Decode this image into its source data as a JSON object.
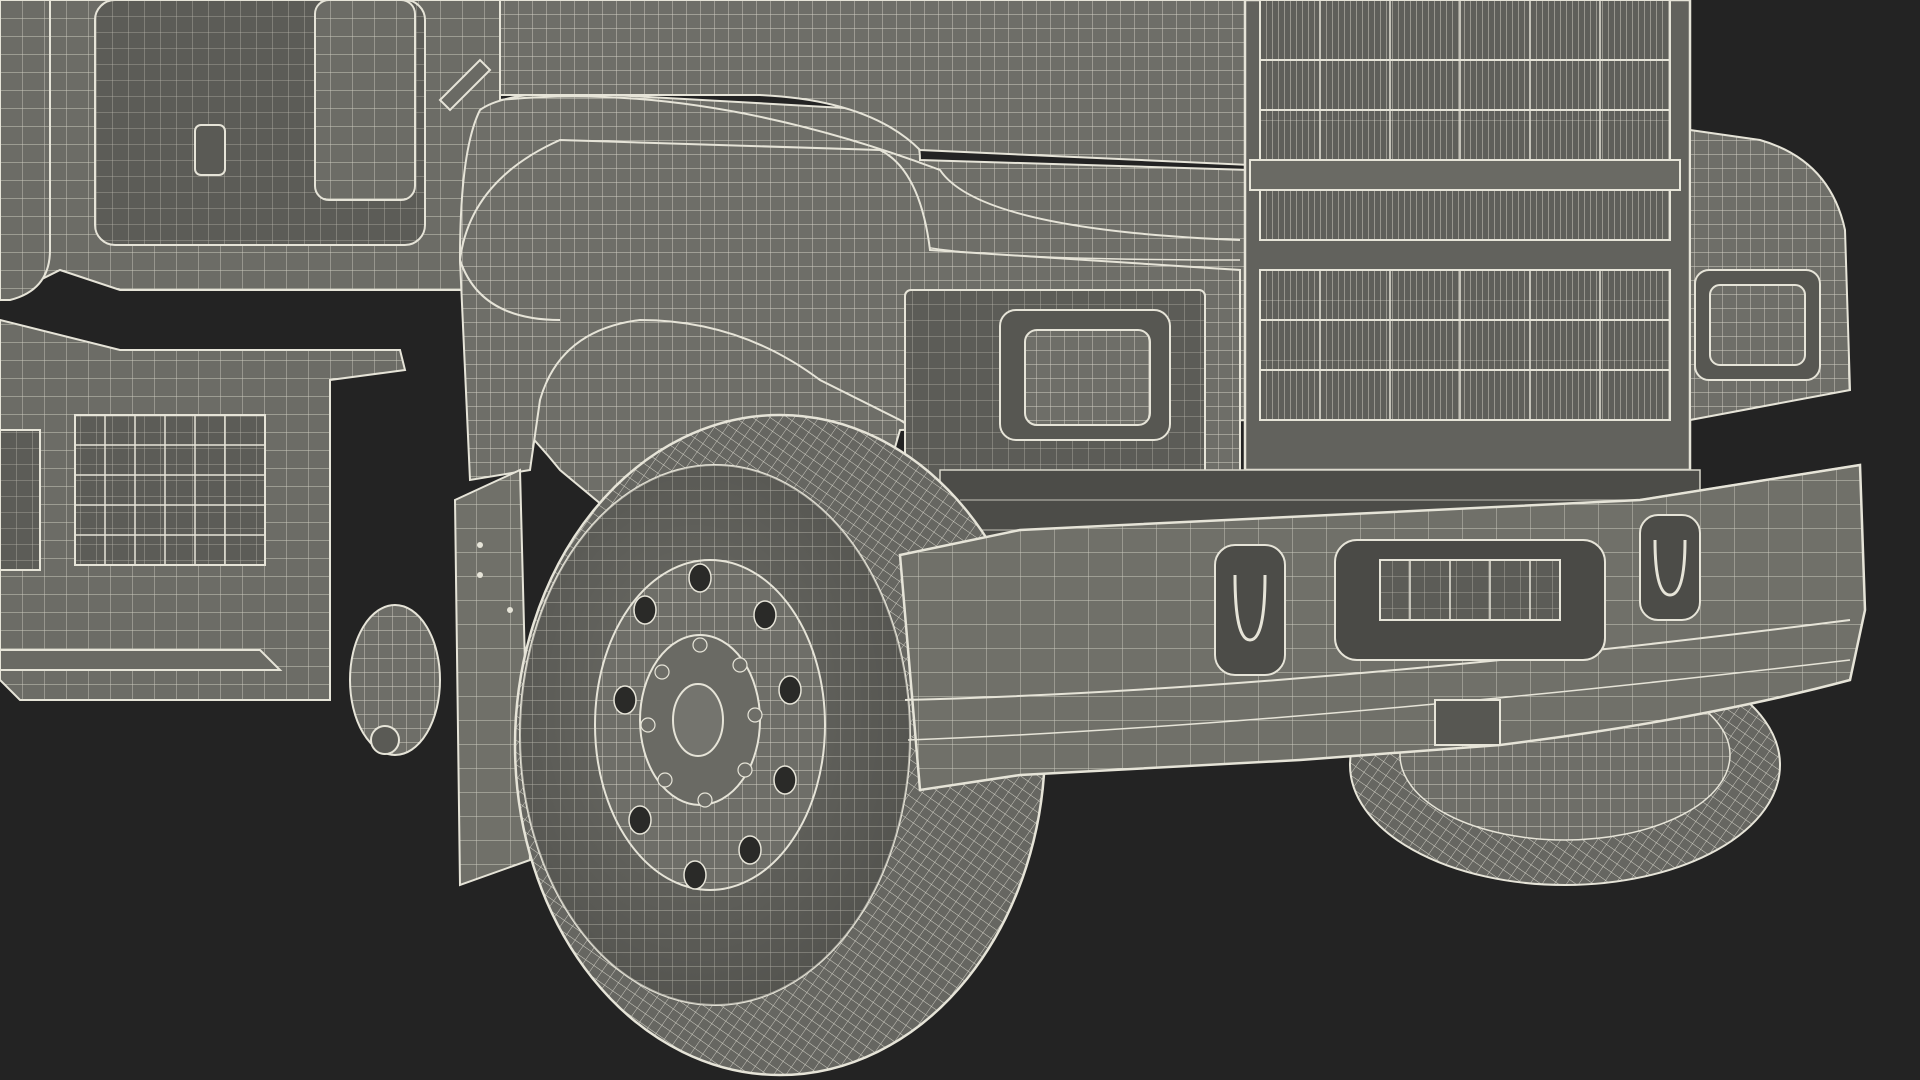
{
  "scene": {
    "subject": "",
    "colors": {
      "background": "#232323",
      "surface": "#6e6e68",
      "surface_dark": "#5a5a55",
      "surface_light": "#7a7a74",
      "wire": "#e8e6da",
      "wire_soft": "#cfcdc0",
      "hole": "#2a2a28"
    }
  }
}
